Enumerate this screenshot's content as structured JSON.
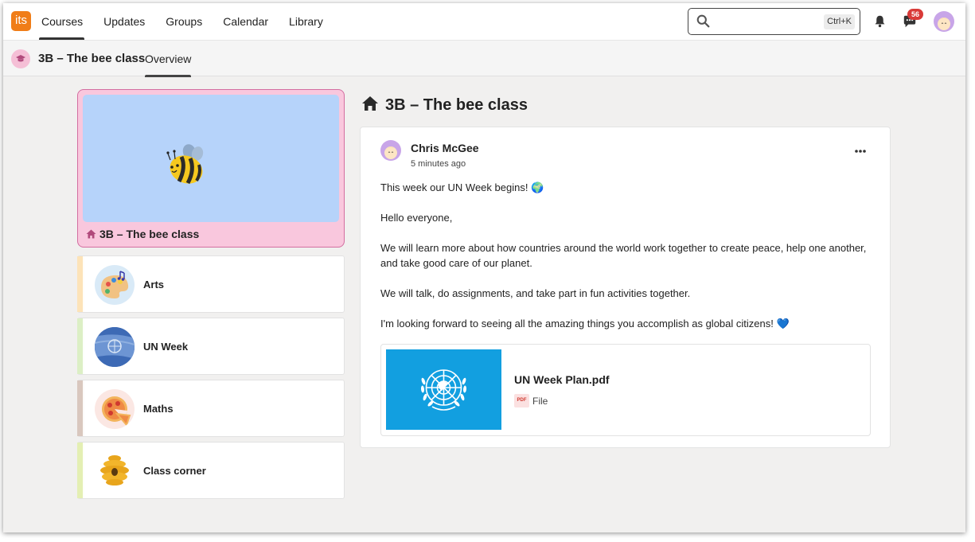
{
  "app": {
    "logo_text": "its",
    "brand_color": "#f07d18"
  },
  "nav": {
    "items": [
      {
        "label": "Courses",
        "active": true
      },
      {
        "label": "Updates",
        "active": false
      },
      {
        "label": "Groups",
        "active": false
      },
      {
        "label": "Calendar",
        "active": false
      },
      {
        "label": "Library",
        "active": false
      }
    ]
  },
  "search": {
    "value": "",
    "placeholder": "",
    "shortcut": "Ctrl+K",
    "icon": "search-icon"
  },
  "notifications": {
    "bell_icon": "bell-icon",
    "chat_icon": "chat-icon",
    "chat_count": "56"
  },
  "subbar": {
    "title": "3B – The bee class",
    "tab": "Overview",
    "icon": "graduation-cap-icon"
  },
  "hero": {
    "label": "3B – The bee class",
    "icon": "home-icon",
    "image": "bee-icon"
  },
  "courses": [
    {
      "name": "Arts",
      "icon": "palette-icon",
      "color": "#fde3b8"
    },
    {
      "name": "UN Week",
      "icon": "un-flag-icon",
      "color": "#dcefc5"
    },
    {
      "name": "Maths",
      "icon": "pizza-icon",
      "color": "#d9c7be"
    },
    {
      "name": "Class corner",
      "icon": "beehive-icon",
      "color": "#e4efb3"
    }
  ],
  "main": {
    "title": "3B – The bee class",
    "title_icon": "home-icon"
  },
  "post": {
    "author": "Chris McGee",
    "time": "5 minutes ago",
    "more_icon": "more-icon",
    "paragraphs": [
      "This week our UN Week begins! 🌍",
      "Hello everyone,",
      "We will learn more about how countries around the world work together to create peace, help one another, and take good care of our planet.",
      "We will talk, do assignments, and take part in fun activities together.",
      "I'm looking forward to seeing all the amazing things you accomplish as global citizens! 💙"
    ],
    "attachment": {
      "name": "UN Week Plan.pdf",
      "type": "File",
      "badge": "PDF",
      "thumb_color": "#129fe0"
    }
  }
}
